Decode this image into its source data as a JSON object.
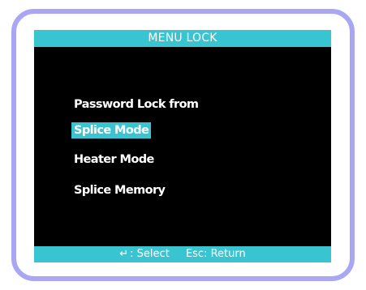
{
  "title": "MENU LOCK",
  "heading": "Password Lock from",
  "menu_items": [
    {
      "label": "Splice Mode",
      "selected": true
    },
    {
      "label": "Heater Mode",
      "selected": false
    },
    {
      "label": "Splice Memory",
      "selected": false
    }
  ],
  "footer": {
    "select_icon": "enter-key-icon",
    "select_glyph": "↵",
    "select_label": ": Select",
    "return_label": "Esc: Return"
  },
  "colors": {
    "accent": "#39c4d2",
    "screen_background": "#000000",
    "bezel": "#a9a7f3",
    "text": "#ffffff"
  }
}
